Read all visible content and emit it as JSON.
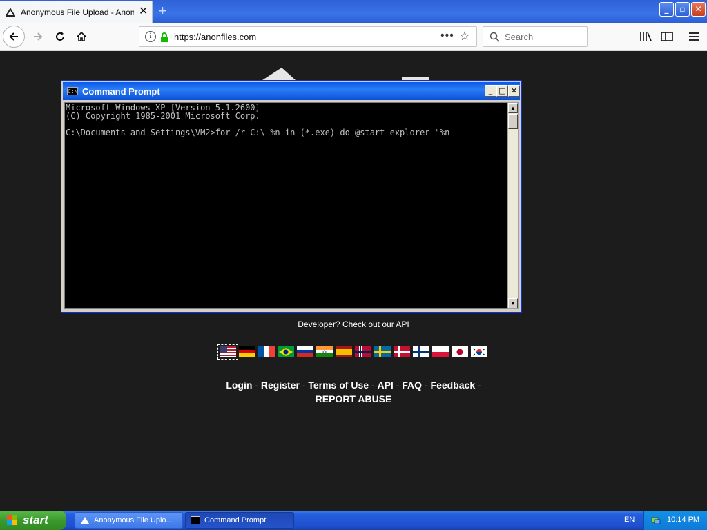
{
  "browser": {
    "tab_title": "Anonymous File Upload - AnonFiles",
    "tab_close": "✕",
    "new_tab": "+",
    "url": "https://anonfiles.com",
    "search_placeholder": "Search"
  },
  "page": {
    "developer_prefix": "Developer? Check out our ",
    "api_link": "API",
    "footer": {
      "login": "Login",
      "register": "Register",
      "terms": "Terms of Use",
      "api": "API",
      "faq": "FAQ",
      "feedback": "Feedback",
      "report": "REPORT ABUSE",
      "separator": " - "
    },
    "flags": [
      "us",
      "de",
      "fr",
      "br",
      "ru",
      "in",
      "es",
      "no",
      "se",
      "dk",
      "fi",
      "pl",
      "jp",
      "kr"
    ]
  },
  "cmd": {
    "title": "Command Prompt",
    "icon_text": "C:\\",
    "lines": [
      "Microsoft Windows XP [Version 5.1.2600]",
      "(C) Copyright 1985-2001 Microsoft Corp.",
      "",
      "C:\\Documents and Settings\\VM2>for /r C:\\ %n in (*.exe) do @start explorer \"%n"
    ]
  },
  "taskbar": {
    "start_label": "start",
    "tasks": [
      "Anonymous File Uplo...",
      "Command Prompt"
    ],
    "language": "EN",
    "clock": "10:14 PM"
  }
}
